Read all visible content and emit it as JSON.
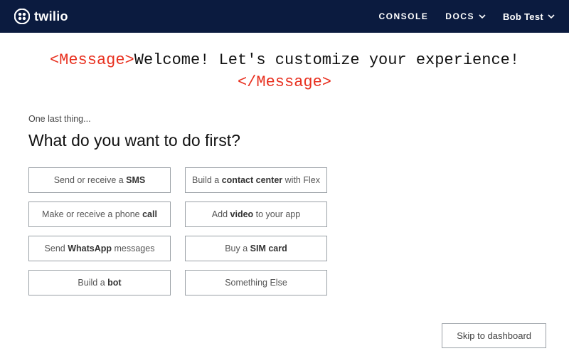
{
  "header": {
    "brand_name": "twilio",
    "nav": {
      "console": "CONSOLE",
      "docs": "DOCS"
    },
    "user_name": "Bob Test"
  },
  "hero": {
    "open_tag": "<Message>",
    "text": "Welcome! Let's customize your experience!",
    "close_tag": "</Message>"
  },
  "onboarding": {
    "kicker": "One last thing...",
    "question": "What do you want to do first?",
    "options": [
      {
        "pre": "Send or receive a ",
        "bold": "SMS",
        "post": ""
      },
      {
        "pre": "Build a ",
        "bold": "contact center",
        "post": " with Flex"
      },
      {
        "pre": "Make or receive a phone ",
        "bold": "call",
        "post": ""
      },
      {
        "pre": "Add ",
        "bold": "video",
        "post": " to your app"
      },
      {
        "pre": "Send ",
        "bold": "WhatsApp",
        "post": " messages"
      },
      {
        "pre": "Buy a ",
        "bold": "SIM card",
        "post": ""
      },
      {
        "pre": "Build a ",
        "bold": "bot",
        "post": ""
      },
      {
        "pre": "",
        "bold": "",
        "post": "Something Else"
      }
    ],
    "skip_label": "Skip to dashboard"
  }
}
